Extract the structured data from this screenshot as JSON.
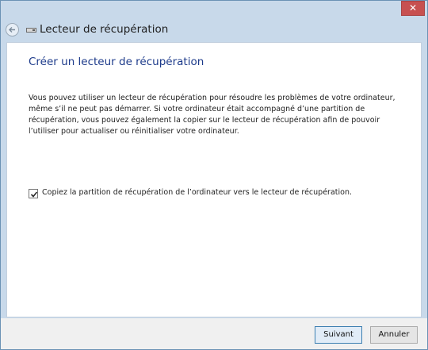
{
  "window": {
    "close_glyph": "✕",
    "accent_close": "#c75050"
  },
  "nav": {
    "title": "Lecteur de récupération",
    "back_icon": "back-arrow-icon",
    "drive_icon": "drive-icon"
  },
  "main": {
    "heading": "Créer un lecteur de récupération",
    "description": "Vous pouvez utiliser un lecteur de récupération pour résoudre les problèmes de votre ordinateur, même s’il ne peut pas démarrer. Si votre ordinateur était accompagné d’une partition de récupération, vous pouvez également la copier sur le lecteur de récupération afin de pouvoir l’utiliser pour actualiser ou réinitialiser votre ordinateur.",
    "checkbox": {
      "label": "Copiez la partition de récupération de l’ordinateur vers le lecteur de récupération.",
      "checked": true
    }
  },
  "footer": {
    "next_label": "Suivant",
    "cancel_label": "Annuler"
  }
}
